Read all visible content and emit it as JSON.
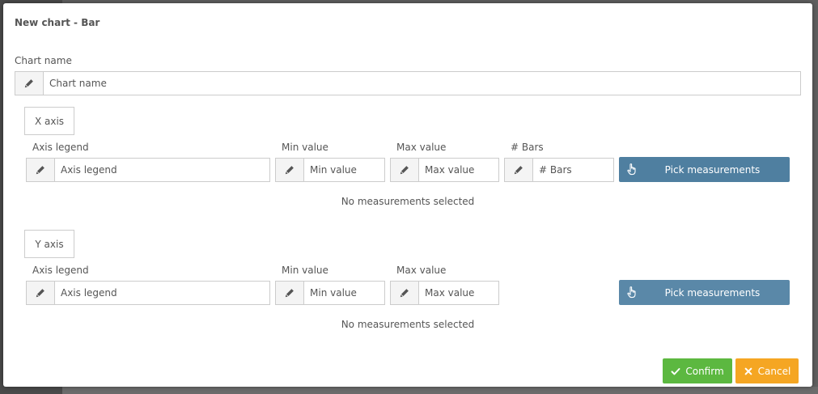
{
  "dialog": {
    "title": "New chart - Bar"
  },
  "chart_name": {
    "label": "Chart name",
    "placeholder": "Chart name",
    "value": ""
  },
  "x_axis": {
    "tab_label": "X axis",
    "axis_legend": {
      "label": "Axis legend",
      "placeholder": "Axis legend",
      "value": ""
    },
    "min_value": {
      "label": "Min value",
      "placeholder": "Min value",
      "value": ""
    },
    "max_value": {
      "label": "Max value",
      "placeholder": "Max value",
      "value": ""
    },
    "bars": {
      "label": "# Bars",
      "placeholder": "# Bars",
      "value": ""
    },
    "pick_button": "Pick measurements",
    "empty_message": "No measurements selected"
  },
  "y_axis": {
    "tab_label": "Y axis",
    "axis_legend": {
      "label": "Axis legend",
      "placeholder": "Axis legend",
      "value": ""
    },
    "min_value": {
      "label": "Min value",
      "placeholder": "Min value",
      "value": ""
    },
    "max_value": {
      "label": "Max value",
      "placeholder": "Max value",
      "value": ""
    },
    "pick_button": "Pick measurements",
    "empty_message": "No measurements selected"
  },
  "footer": {
    "confirm_label": "Confirm",
    "cancel_label": "Cancel"
  },
  "icons": {
    "field_icon": "pencil-icon",
    "pick_icon": "hand-pointer-icon",
    "confirm_icon": "check-icon",
    "cancel_icon": "times-icon"
  },
  "colors": {
    "pick_button": "#4f7fa0",
    "pick_button_alt": "#5a88a8",
    "confirm": "#5cb840",
    "cancel": "#f5a623",
    "overlay": "#5f5f5f"
  }
}
